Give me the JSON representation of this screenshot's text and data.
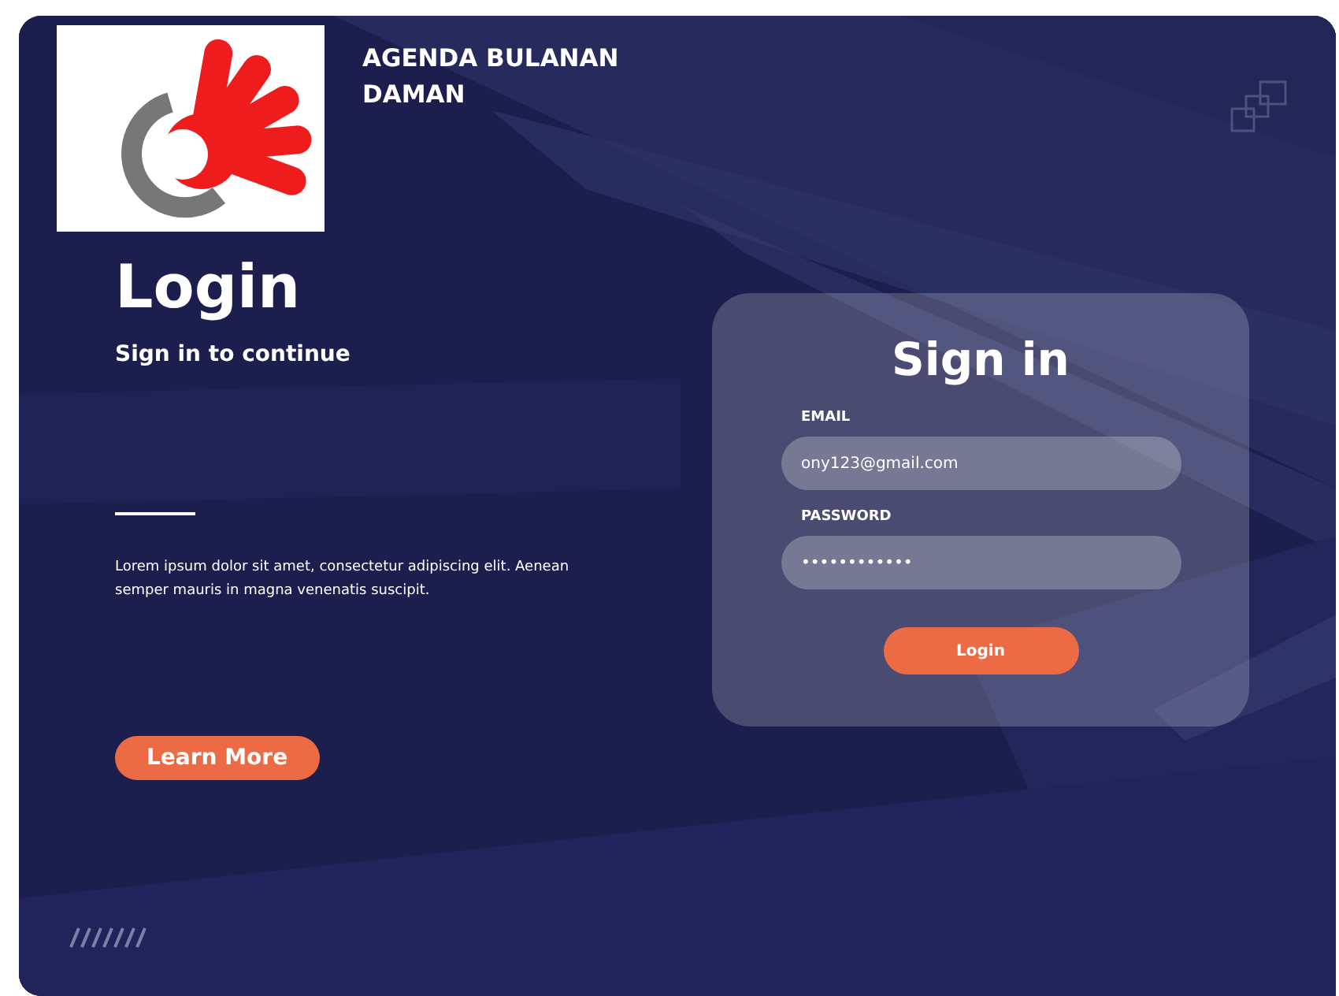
{
  "header": {
    "title_lines": [
      "AGENDA BULANAN",
      "DAMAN"
    ]
  },
  "intro": {
    "heading": "Login",
    "subheading": "Sign in to continue",
    "text": "Lorem ipsum dolor sit amet, consectetur adipiscing elit. Aenean semper mauris in magna venenatis suscipit.",
    "button": "Learn More"
  },
  "signin": {
    "title": "Sign in",
    "fields": [
      {
        "label": "EMAIL",
        "value": "ony123@gmail.com"
      },
      {
        "label": "PASSWORD",
        "value": "••••••••••••"
      }
    ],
    "button": "Login"
  }
}
